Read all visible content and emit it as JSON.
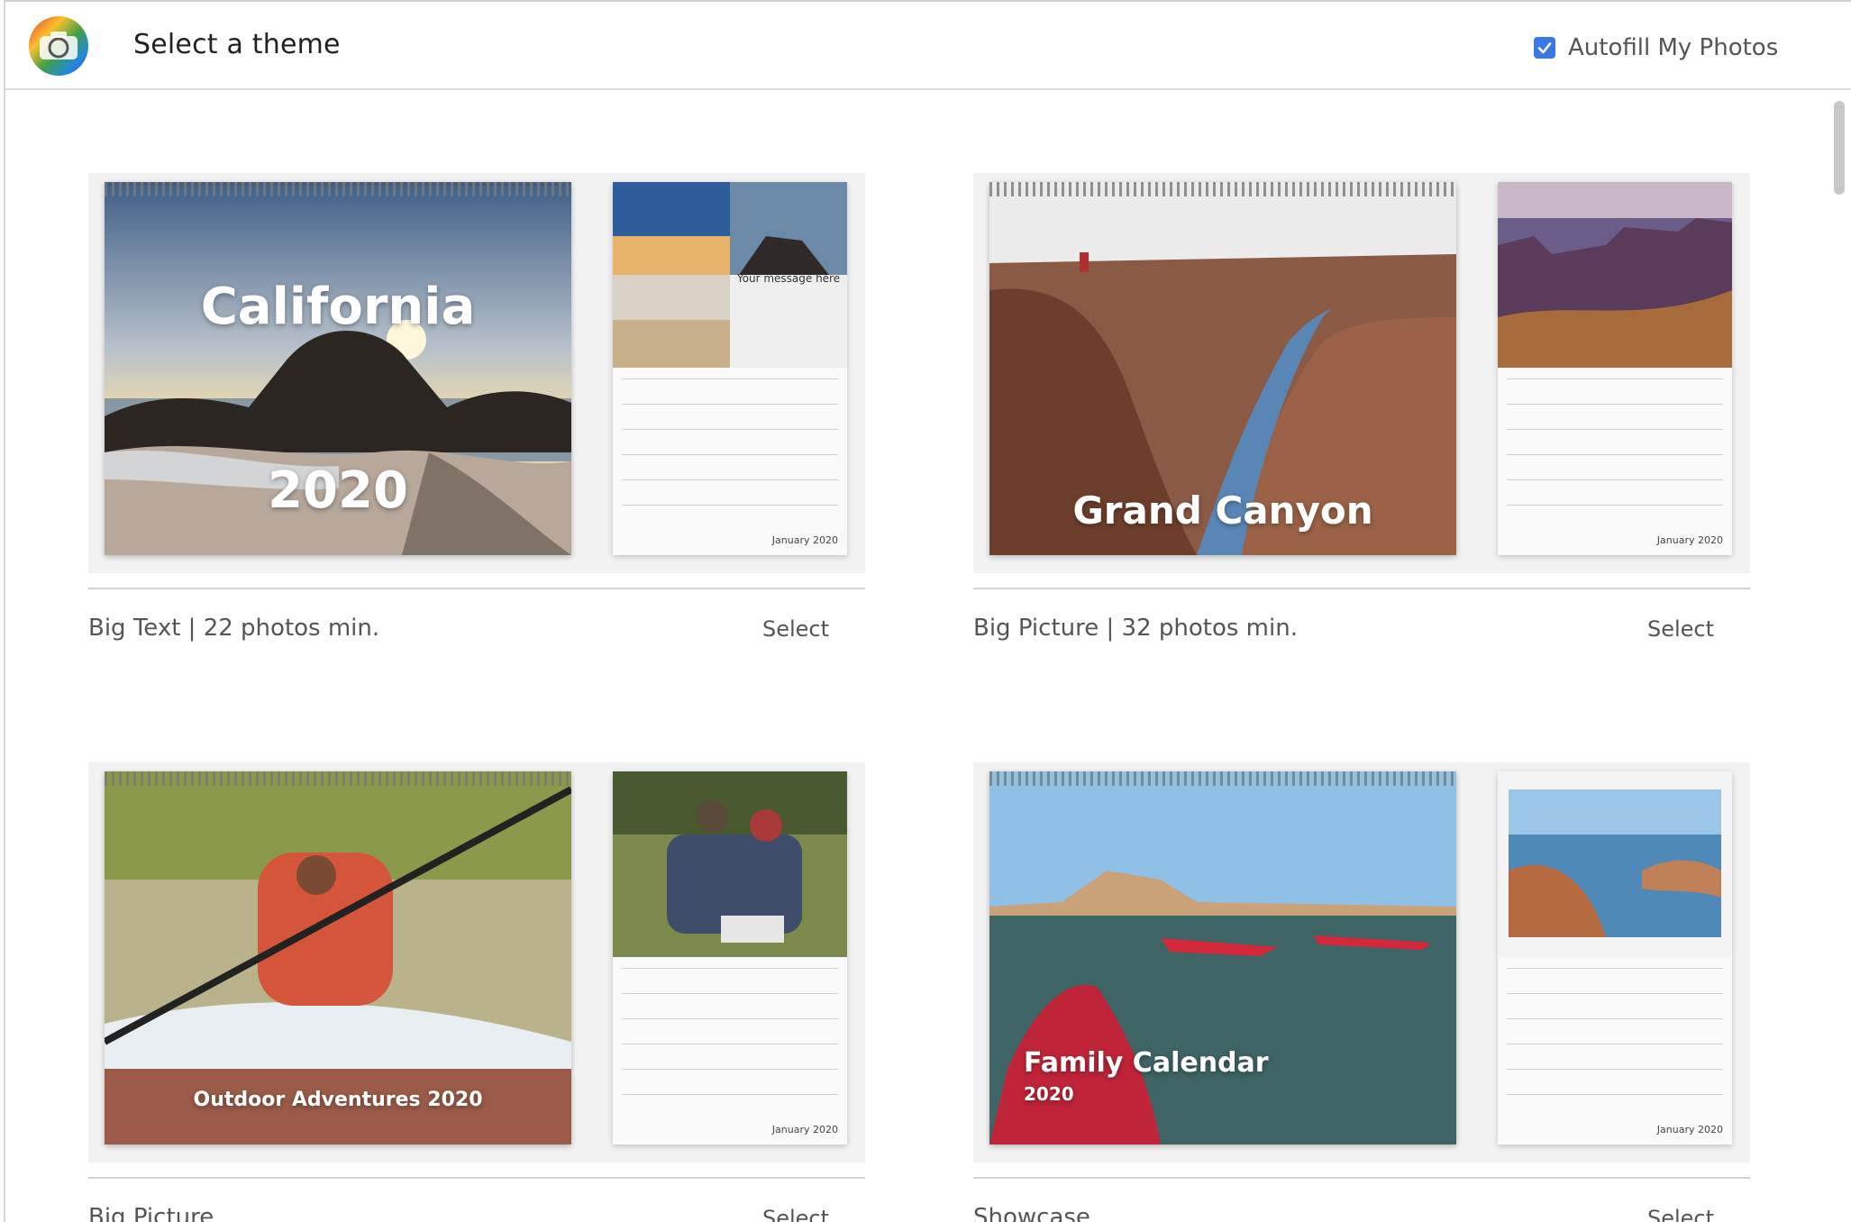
{
  "header": {
    "title": "Select a theme",
    "autofill_label": "Autofill My Photos",
    "autofill_checked": true,
    "accent_color": "#3b78e7"
  },
  "themes": [
    {
      "name": "Big Text | 22 photos min.",
      "select_label": "Select",
      "cover_text_top": "California",
      "cover_text_bottom": "2020",
      "month_message": "Your message here",
      "month_caption": "January 2020"
    },
    {
      "name": "Big Picture | 32 photos min.",
      "select_label": "Select",
      "cover_text_bottom": "Grand Canyon",
      "month_caption": "January 2020"
    },
    {
      "name": "Big Picture",
      "select_label": "Select",
      "cover_text_bottom": "Outdoor Adventures 2020",
      "month_caption": "January 2020"
    },
    {
      "name": "Showcase",
      "select_label": "Select",
      "cover_text_top": "Family Calendar",
      "cover_text_bottom": "2020",
      "month_caption": "January 2020"
    }
  ]
}
